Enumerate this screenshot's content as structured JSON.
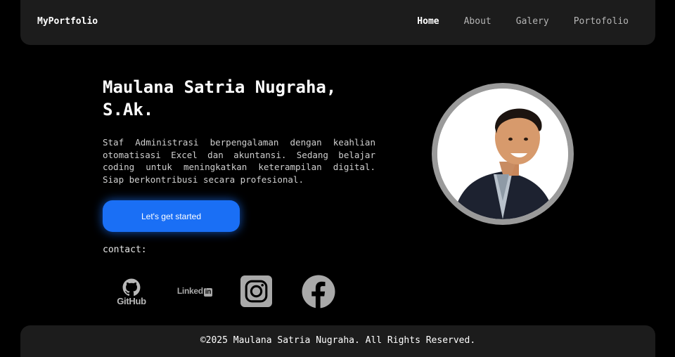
{
  "navbar": {
    "brand": "MyPortfolio",
    "links": [
      {
        "label": "Home",
        "active": true
      },
      {
        "label": "About",
        "active": false
      },
      {
        "label": "Galery",
        "active": false
      },
      {
        "label": "Portofolio",
        "active": false
      }
    ]
  },
  "hero": {
    "name": "Maulana Satria Nugraha, S.Ak.",
    "description": "Staf Administrasi berpengalaman dengan keahlian otomatisasi Excel dan akuntansi. Sedang belajar coding untuk meningkatkan keterampilan digital. Siap berkontribusi secara profesional.",
    "cta_label": "Let's get started",
    "contact_label": "contact:"
  },
  "socials": [
    {
      "name": "GitHub",
      "icon": "github-icon"
    },
    {
      "name": "LinkedIn",
      "text": "Linked",
      "box": "in",
      "icon": "linkedin-icon"
    },
    {
      "name": "Instagram",
      "icon": "instagram-icon"
    },
    {
      "name": "Facebook",
      "icon": "facebook-icon"
    }
  ],
  "profile": {
    "icon": "profile-photo"
  },
  "footer": {
    "text": "©2025 Maulana Satria Nugraha. All Rights Reserved."
  },
  "colors": {
    "background": "#000000",
    "panel": "#1c1c1c",
    "accent": "#1a6ff5",
    "avatar_ring": "#9a9a9a"
  }
}
